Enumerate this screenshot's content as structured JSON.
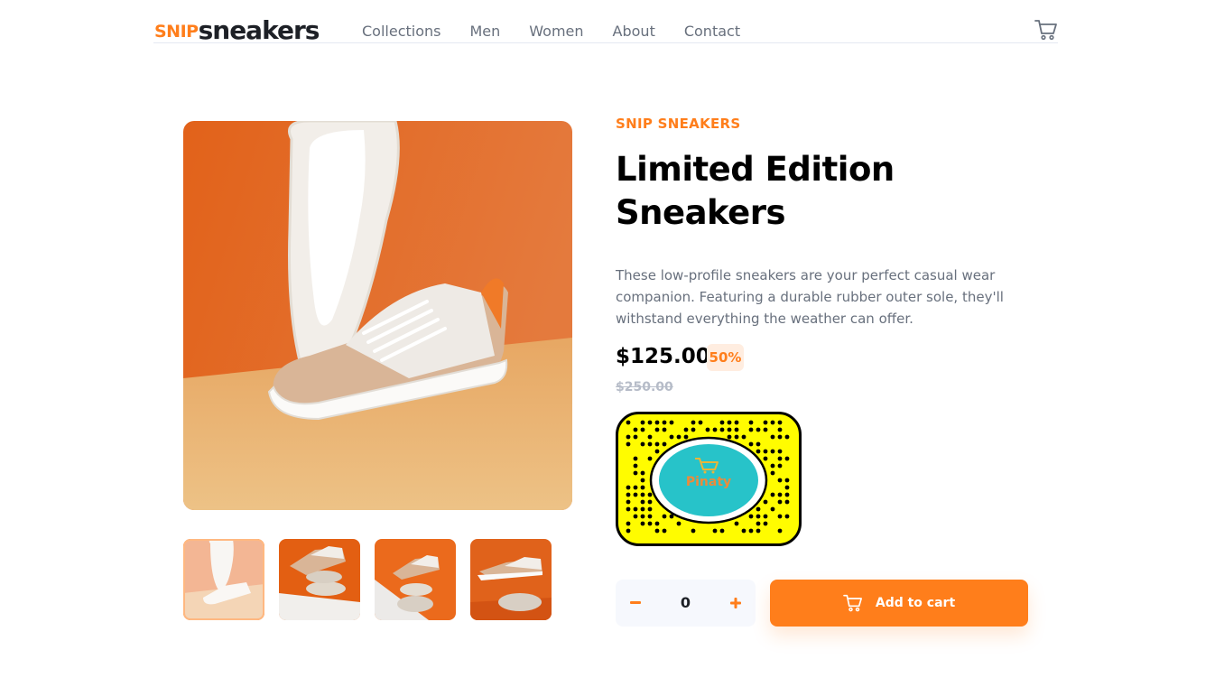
{
  "header": {
    "logo_snip": "SNIP",
    "logo_sneakers": "sneakers",
    "nav": [
      "Collections",
      "Men",
      "Women",
      "About",
      "Contact"
    ],
    "cart_icon": "cart-icon"
  },
  "product": {
    "company": "SNIP SNEAKERS",
    "title": "Limited Edition Sneakers",
    "description": "These low-profile sneakers are your perfect casual wear companion. Featuring a durable rubber outer sole, they'll withstand everything the weather can offer.",
    "price": "$125.00",
    "discount": "50%",
    "old_price": "$250.00",
    "snapcode_label": "Pinaty"
  },
  "gallery": {
    "thumbnails": [
      "thumbnail-1",
      "thumbnail-2",
      "thumbnail-3",
      "thumbnail-4"
    ],
    "active_index": 0
  },
  "cart_controls": {
    "quantity": "0",
    "add_label": "Add to cart"
  },
  "colors": {
    "accent": "#ff7e1b",
    "accent_pale": "#ffede0",
    "text_dark": "#1d2026",
    "text_grey": "#68707d",
    "snapcode_yellow": "#fffc00",
    "snapcode_circle": "#27c3c9"
  }
}
